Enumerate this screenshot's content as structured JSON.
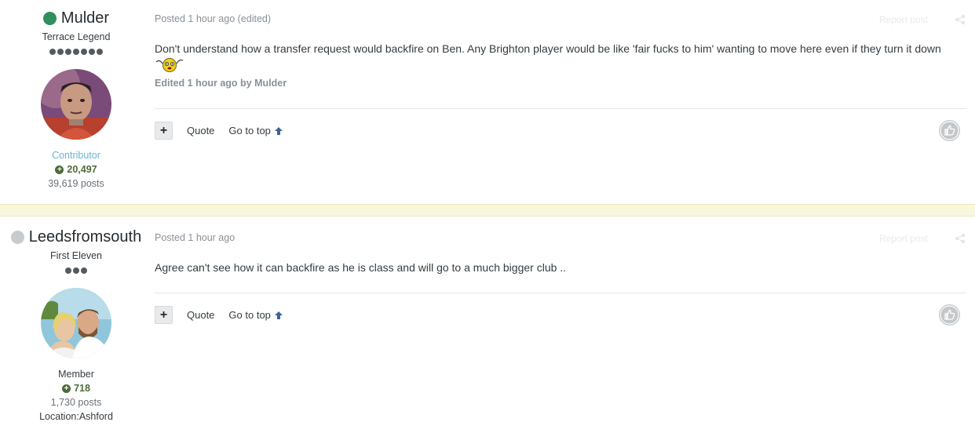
{
  "posts": [
    {
      "author": {
        "name": "Mulder",
        "status_color": "#2f8f5e",
        "rank_title": "Terrace Legend",
        "pips": 7,
        "group": "Contributor",
        "group_color": "#6eb3d4",
        "reputation": "20,497",
        "post_count": "39,619 posts"
      },
      "meta": "Posted 1 hour ago (edited)",
      "report_label": "Report post",
      "content": "Don't understand how a transfer request would backfire on Ben. Any Brighton player would be like 'fair fucks to him' wanting to move here even if they turn it down",
      "edited_note": "Edited 1 hour ago by Mulder",
      "quote_label": "Quote",
      "gototop_label": "Go to top"
    },
    {
      "author": {
        "name": "Leedsfromsouth",
        "status_color": "#c8cbcd",
        "rank_title": "First Eleven",
        "pips": 3,
        "group": "Member",
        "group_color": "#353c41",
        "reputation": "718",
        "post_count": "1,730 posts",
        "location": "Location:Ashford"
      },
      "meta": "Posted 1 hour ago",
      "report_label": "Report post",
      "content": "Agree can't see how it can backfire as he is class and will go to a much bigger club ..",
      "quote_label": "Quote",
      "gototop_label": "Go to top"
    }
  ]
}
